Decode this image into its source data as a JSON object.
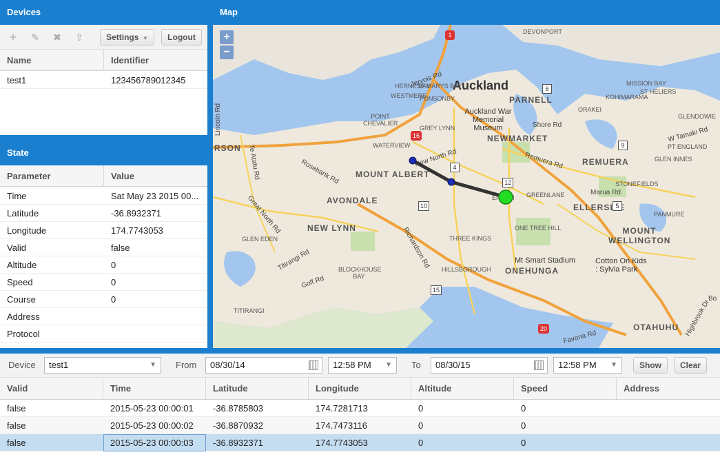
{
  "devices": {
    "title": "Devices",
    "settings_label": "Settings",
    "logout_label": "Logout",
    "columns": [
      "Name",
      "Identifier"
    ],
    "rows": [
      {
        "name": "test1",
        "identifier": "123456789012345"
      }
    ]
  },
  "state": {
    "title": "State",
    "columns": [
      "Parameter",
      "Value"
    ],
    "rows": [
      {
        "param": "Time",
        "value": "Sat May 23 2015 00..."
      },
      {
        "param": "Latitude",
        "value": "-36.8932371"
      },
      {
        "param": "Longitude",
        "value": "174.7743053"
      },
      {
        "param": "Valid",
        "value": "false"
      },
      {
        "param": "Altitude",
        "value": "0"
      },
      {
        "param": "Speed",
        "value": "0"
      },
      {
        "param": "Course",
        "value": "0"
      },
      {
        "param": "Address",
        "value": ""
      },
      {
        "param": "Protocol",
        "value": ""
      }
    ]
  },
  "map": {
    "title": "Map",
    "zoom_in": "+",
    "zoom_out": "−",
    "labels": {
      "city": "Auckland",
      "museum": "Auckland War Memorial Museum",
      "parnell": "PARNELL",
      "newmarket": "NEWMARKET",
      "remuera": "REMUERA",
      "mount_albert": "MOUNT ALBERT",
      "avondale": "AVONDALE",
      "new_lynn": "NEW LYNN",
      "ellerslie": "ELLERSLIE",
      "mount_wellington": "MOUNT WELLINGTON",
      "onehunga": "ONEHUNGA",
      "stadium": "Mt Smart Stadium",
      "cotton_on": "Cotton On Kids : Sylvia Park",
      "devonport": "DEVONPORT",
      "st_heliers": "ST HELIERS",
      "glendowie": "GLENDOWIE",
      "titirangi": "TITIRANGI",
      "otahuhu": "OTAHUHU",
      "epsom": "EPSOM",
      "three_kings": "THREE KINGS",
      "blockhouse_bay": "BLOCKHOUSE BAY",
      "hillsborough": "HILLSBOROUGH",
      "one_tree_hill": "ONE TREE HILL",
      "greenlane": "GREENLANE",
      "stonefields": "STONEFIELDS",
      "glen_innes": "GLEN INNES",
      "glen_eden": "GLEN EDEN",
      "point_chevalier": "POINT CHEVALIER",
      "grey_lynn": "GREY LYNN",
      "ponsonby": "PONSONBY",
      "westmere": "WESTMERE",
      "st_marys_bay": "ST MARYS BAY",
      "herne_bay": "HERNE BAY",
      "ellerslie_panmure": "PANMURE",
      "orakei": "ORAKEI",
      "kohimarama": "KOHIMARAMA",
      "pt_england": "PT ENGLAND",
      "mission_bay": "MISSION BAY",
      "west_harbour": "RSON",
      "waterview": "WATERVIEW",
      "new_north_rd": "New North Rd",
      "remuera_rd": "Remuera Rd",
      "great_north_rd": "Great North Rd",
      "rosebank_rd": "Rosebank Rd",
      "richardson_rd": "Richardson Rd",
      "te_atatu_rd": "Te Atatu Rd",
      "titirangi_rd": "Titirangi Rd",
      "golf_rd": "Golf Rd",
      "shore_rd": "Shore Rd",
      "marua_rd": "Marua Rd",
      "jervois_rd": "Jervois Rd",
      "lincoln_rd": "Lincoln Rd",
      "favona_rd": "Favona Rd",
      "highbrook_dr": "Highbrook Dr",
      "w_tamaki_rd": "W Tamaki Rd",
      "bo": "Bo"
    },
    "route_shields": [
      "1",
      "16",
      "20",
      "4",
      "5",
      "6",
      "9",
      "10",
      "12",
      "15"
    ]
  },
  "history": {
    "device_label": "Device",
    "device_value": "test1",
    "from_label": "From",
    "from_date": "08/30/14",
    "from_time": "12:58 PM",
    "to_label": "To",
    "to_date": "08/30/15",
    "to_time": "12:58 PM",
    "show_label": "Show",
    "clear_label": "Clear",
    "columns": [
      "Valid",
      "Time",
      "Latitude",
      "Longitude",
      "Altitude",
      "Speed",
      "Address"
    ],
    "rows": [
      {
        "valid": "false",
        "time": "2015-05-23 00:00:01",
        "lat": "-36.8785803",
        "lon": "174.7281713",
        "alt": "0",
        "speed": "0",
        "address": ""
      },
      {
        "valid": "false",
        "time": "2015-05-23 00:00:02",
        "lat": "-36.8870932",
        "lon": "174.7473116",
        "alt": "0",
        "speed": "0",
        "address": ""
      },
      {
        "valid": "false",
        "time": "2015-05-23 00:00:03",
        "lat": "-36.8932371",
        "lon": "174.7743053",
        "alt": "0",
        "speed": "0",
        "address": ""
      }
    ],
    "selected_row": 2
  },
  "colors": {
    "header_blue": "#1a7fcf",
    "selected_row": "#c5ddf1",
    "track_line": "#333333",
    "track_point": "#1c2fb3",
    "current_position": "#22dd22"
  }
}
